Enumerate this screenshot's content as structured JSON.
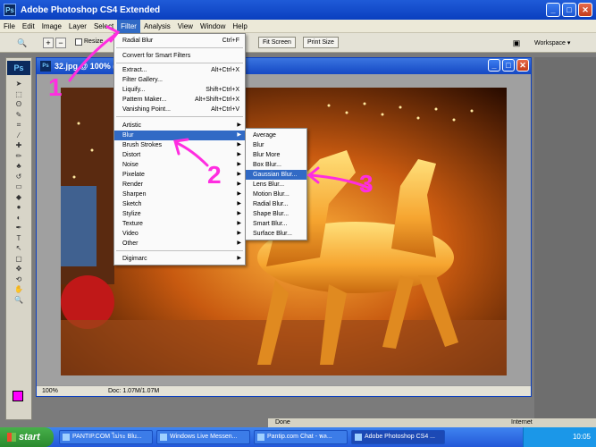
{
  "app": {
    "title": "Adobe Photoshop CS4 Extended",
    "logo": "Ps"
  },
  "menubar": [
    "File",
    "Edit",
    "Image",
    "Layer",
    "Select",
    "Filter",
    "Analysis",
    "View",
    "Window",
    "Help"
  ],
  "options_bar": {
    "resize_label": "Resize",
    "buttons": [
      "Fit Screen",
      "Print Size"
    ],
    "workspace": "Workspace ▾"
  },
  "document": {
    "title": "32.jpg @ 100% (R",
    "zoom": "100%",
    "doc_info": "Doc: 1.07M/1.07M"
  },
  "filter_menu": {
    "items": [
      {
        "label": "Radial Blur",
        "shortcut": "Ctrl+F"
      },
      {
        "label": "Convert for Smart Filters",
        "shortcut": ""
      },
      {
        "label": "Extract...",
        "shortcut": "Alt+Ctrl+X"
      },
      {
        "label": "Filter Gallery...",
        "shortcut": ""
      },
      {
        "label": "Liquify...",
        "shortcut": "Shift+Ctrl+X"
      },
      {
        "label": "Pattern Maker...",
        "shortcut": "Alt+Shift+Ctrl+X"
      },
      {
        "label": "Vanishing Point...",
        "shortcut": "Alt+Ctrl+V"
      },
      {
        "label": "Artistic",
        "shortcut": ""
      },
      {
        "label": "Blur",
        "shortcut": ""
      },
      {
        "label": "Brush Strokes",
        "shortcut": ""
      },
      {
        "label": "Distort",
        "shortcut": ""
      },
      {
        "label": "Noise",
        "shortcut": ""
      },
      {
        "label": "Pixelate",
        "shortcut": ""
      },
      {
        "label": "Render",
        "shortcut": ""
      },
      {
        "label": "Sharpen",
        "shortcut": ""
      },
      {
        "label": "Sketch",
        "shortcut": ""
      },
      {
        "label": "Stylize",
        "shortcut": ""
      },
      {
        "label": "Texture",
        "shortcut": ""
      },
      {
        "label": "Video",
        "shortcut": ""
      },
      {
        "label": "Other",
        "shortcut": ""
      },
      {
        "label": "Digimarc",
        "shortcut": ""
      }
    ]
  },
  "blur_submenu": {
    "items": [
      "Average",
      "Blur",
      "Blur More",
      "Box Blur...",
      "Gaussian Blur...",
      "Lens Blur...",
      "Motion Blur...",
      "Radial Blur...",
      "Shape Blur...",
      "Smart Blur...",
      "Surface Blur..."
    ]
  },
  "annotations": [
    "1",
    "2",
    "3"
  ],
  "browser_status": {
    "left": "Done",
    "right": "Internet"
  },
  "taskbar": {
    "start": "start",
    "tasks": [
      "PANTIP.COM ไม่ระ Blu...",
      "Windows Live Messen...",
      "Pantip.com Chat - พล...",
      "Adobe Photoshop CS4 ..."
    ],
    "clock": "10:05"
  },
  "colors": {
    "accent": "#316ac5",
    "annotation": "#ff2de0",
    "foreground_swatch": "#ff00ff"
  }
}
